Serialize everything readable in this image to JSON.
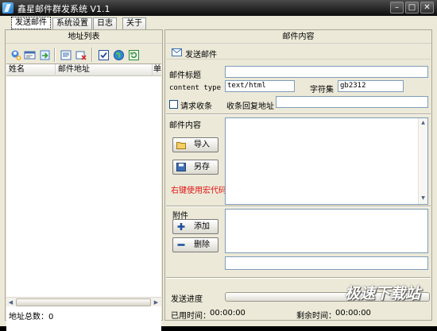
{
  "window": {
    "title": "鑫星邮件群发系统 V1.1"
  },
  "tabs": [
    {
      "label": "发送邮件"
    },
    {
      "label": "系统设置"
    },
    {
      "label": "日志"
    },
    {
      "label": "关于"
    }
  ],
  "address_panel": {
    "title": "地址列表",
    "toolbar": [
      "add-contact-icon",
      "card-icon",
      "import-icon",
      "edit-icon",
      "delete-icon",
      "check-icon",
      "globe-icon",
      "refresh-icon"
    ],
    "columns": [
      "姓名",
      "邮件地址",
      "单"
    ],
    "status": "地址总数：0"
  },
  "mail_panel": {
    "title": "邮件内容",
    "send_label": "发送邮件",
    "subject_label": "邮件标题",
    "subject_value": "",
    "content_type_label": "content type",
    "content_type_value": "text/html",
    "charset_label": "字符集",
    "charset_value": "gb2312",
    "receipt_label": "请求收条",
    "reply_label": "收条回复地址",
    "reply_value": "",
    "content_label": "邮件内容",
    "import_label": "导入",
    "save_label": "另存",
    "macro_hint": "右键使用宏代码",
    "attach_label": "附件",
    "add_label": "添加",
    "remove_label": "删除",
    "progress_label": "发送进度",
    "progress_value": 0,
    "elapsed_label": "已用时间：",
    "elapsed_value": "00:00:00",
    "remaining_label": "剩余时间：",
    "remaining_value": "00:00:00"
  },
  "watermark": "极速下载站",
  "colors": {
    "titlebar": "#1a1a1a",
    "hint_red": "#e01010",
    "background": "#ece9d8"
  }
}
